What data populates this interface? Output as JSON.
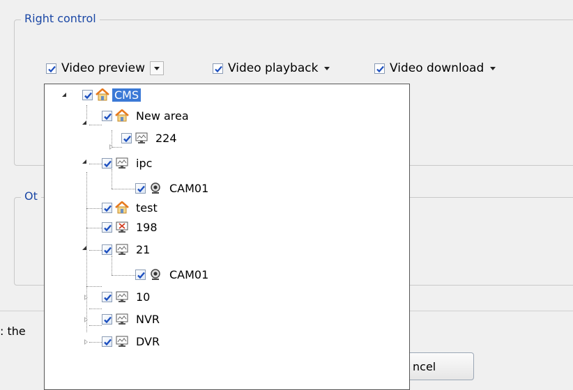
{
  "right_control": {
    "title": "Right control",
    "permissions": [
      {
        "label": "Video preview",
        "checked": true
      },
      {
        "label": "Video playback",
        "checked": true
      },
      {
        "label": "Video download",
        "checked": true
      }
    ]
  },
  "other_group": {
    "title_fragment": "Ot"
  },
  "note_fragment": ": the",
  "cancel_button": {
    "label_fragment": "ncel"
  },
  "device_tree": [
    {
      "label": "CMS",
      "icon": "home-icon",
      "checked": true,
      "selected": true
    },
    {
      "label": "New area",
      "icon": "home-icon",
      "checked": true
    },
    {
      "label": "224",
      "icon": "monitor-icon",
      "checked": true
    },
    {
      "label": "ipc",
      "icon": "monitor-icon",
      "checked": true
    },
    {
      "label": "CAM01",
      "icon": "camera-icon",
      "checked": true
    },
    {
      "label": "test",
      "icon": "home-icon",
      "checked": true
    },
    {
      "label": "198",
      "icon": "monitor-offline-icon",
      "checked": true
    },
    {
      "label": "21",
      "icon": "monitor-icon",
      "checked": true
    },
    {
      "label": "CAM01",
      "icon": "camera-icon",
      "checked": true
    },
    {
      "label": "10",
      "icon": "monitor-icon",
      "checked": true
    },
    {
      "label": "NVR",
      "icon": "monitor-icon",
      "checked": true
    },
    {
      "label": "DVR",
      "icon": "monitor-icon",
      "checked": true
    }
  ],
  "colors": {
    "selection": "#3b79d6",
    "check": "#1c4fbf",
    "home_roof": "#e87a1e"
  }
}
